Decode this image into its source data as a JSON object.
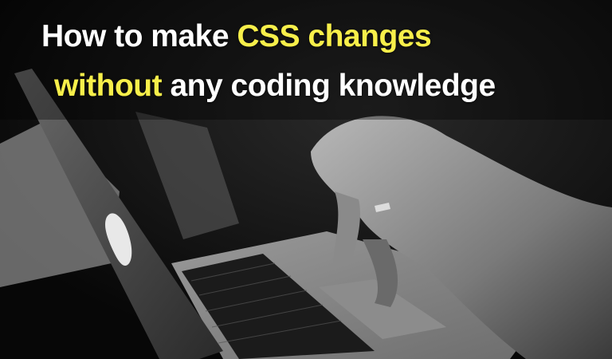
{
  "headline": {
    "line1": [
      {
        "text": "How to make ",
        "highlight": false
      },
      {
        "text": "CSS changes",
        "highlight": true
      }
    ],
    "line2": [
      {
        "text": "without",
        "highlight": true
      },
      {
        "text": " any coding knowledge",
        "highlight": false
      }
    ]
  },
  "colors": {
    "highlight": "#f7ef4a",
    "text": "#ffffff",
    "background": "#0b0b0b"
  }
}
